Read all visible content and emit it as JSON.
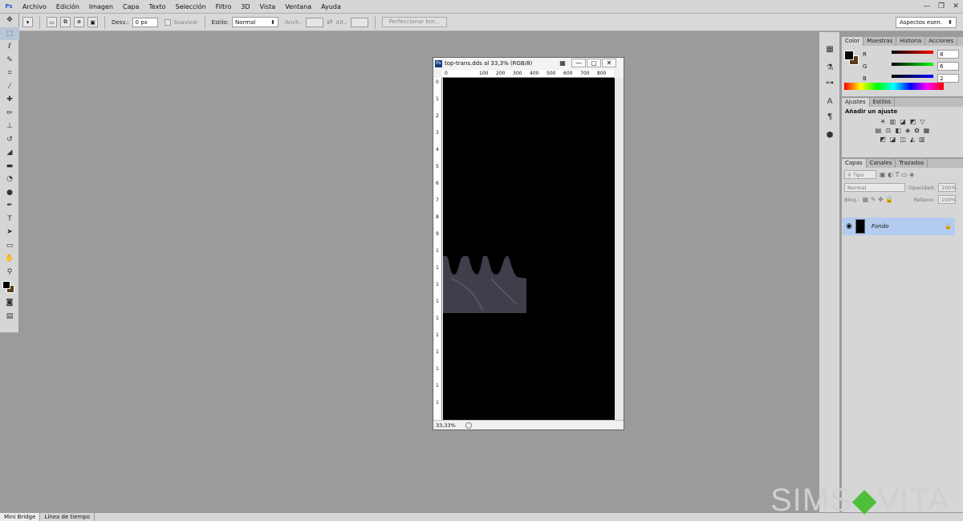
{
  "app": {
    "logo": "Ps"
  },
  "menu": [
    "Archivo",
    "Edición",
    "Imagen",
    "Capa",
    "Texto",
    "Selección",
    "Filtro",
    "3D",
    "Vista",
    "Ventana",
    "Ayuda"
  ],
  "options": {
    "desv_label": "Desv.:",
    "desv_value": "0 px",
    "suavizar": "Suavizar",
    "estilo_label": "Estilo:",
    "estilo_value": "Normal",
    "anch_label": "Anch.:",
    "alt_label": "Alt.:",
    "perfeccionar": "Perfeccionar bor...",
    "workspace": "Aspectos esen."
  },
  "document": {
    "title": "top-trans.dds al 33,3% (RGB/8)",
    "zoom": "33,33%",
    "ruler_h": [
      "0",
      "100",
      "200",
      "300",
      "400",
      "500",
      "600",
      "700",
      "800",
      "900"
    ],
    "ruler_v": [
      "0",
      "1",
      "2",
      "3",
      "4",
      "5",
      "6",
      "7",
      "8",
      "9",
      "1",
      "1",
      "1",
      "1",
      "1",
      "1",
      "1",
      "1",
      "1",
      "1"
    ]
  },
  "color_panel": {
    "tabs": [
      "Color",
      "Muestras",
      "Historia",
      "Acciones"
    ],
    "r_label": "R",
    "r_value": "8",
    "g_label": "G",
    "g_value": "6",
    "b_label": "B",
    "b_value": "2",
    "fg": "#080602",
    "bg": "#5a3d18"
  },
  "adjust_panel": {
    "tabs": [
      "Ajustes",
      "Estilos"
    ],
    "heading": "Añadir un ajuste"
  },
  "layers_panel": {
    "tabs": [
      "Capas",
      "Canales",
      "Trazados"
    ],
    "filter": "Tipo",
    "blend": "Normal",
    "opacity_label": "Opacidad:",
    "opacity_value": "100%",
    "lock_label": "Bloq.:",
    "fill_label": "Relleno:",
    "fill_value": "100%",
    "layer_name": "Fondo"
  },
  "bottom_tabs": [
    "Mini Bridge",
    "Línea de tiempo"
  ],
  "watermark": {
    "left": "SIMS",
    "mark": "◆",
    "right": "VITA"
  }
}
